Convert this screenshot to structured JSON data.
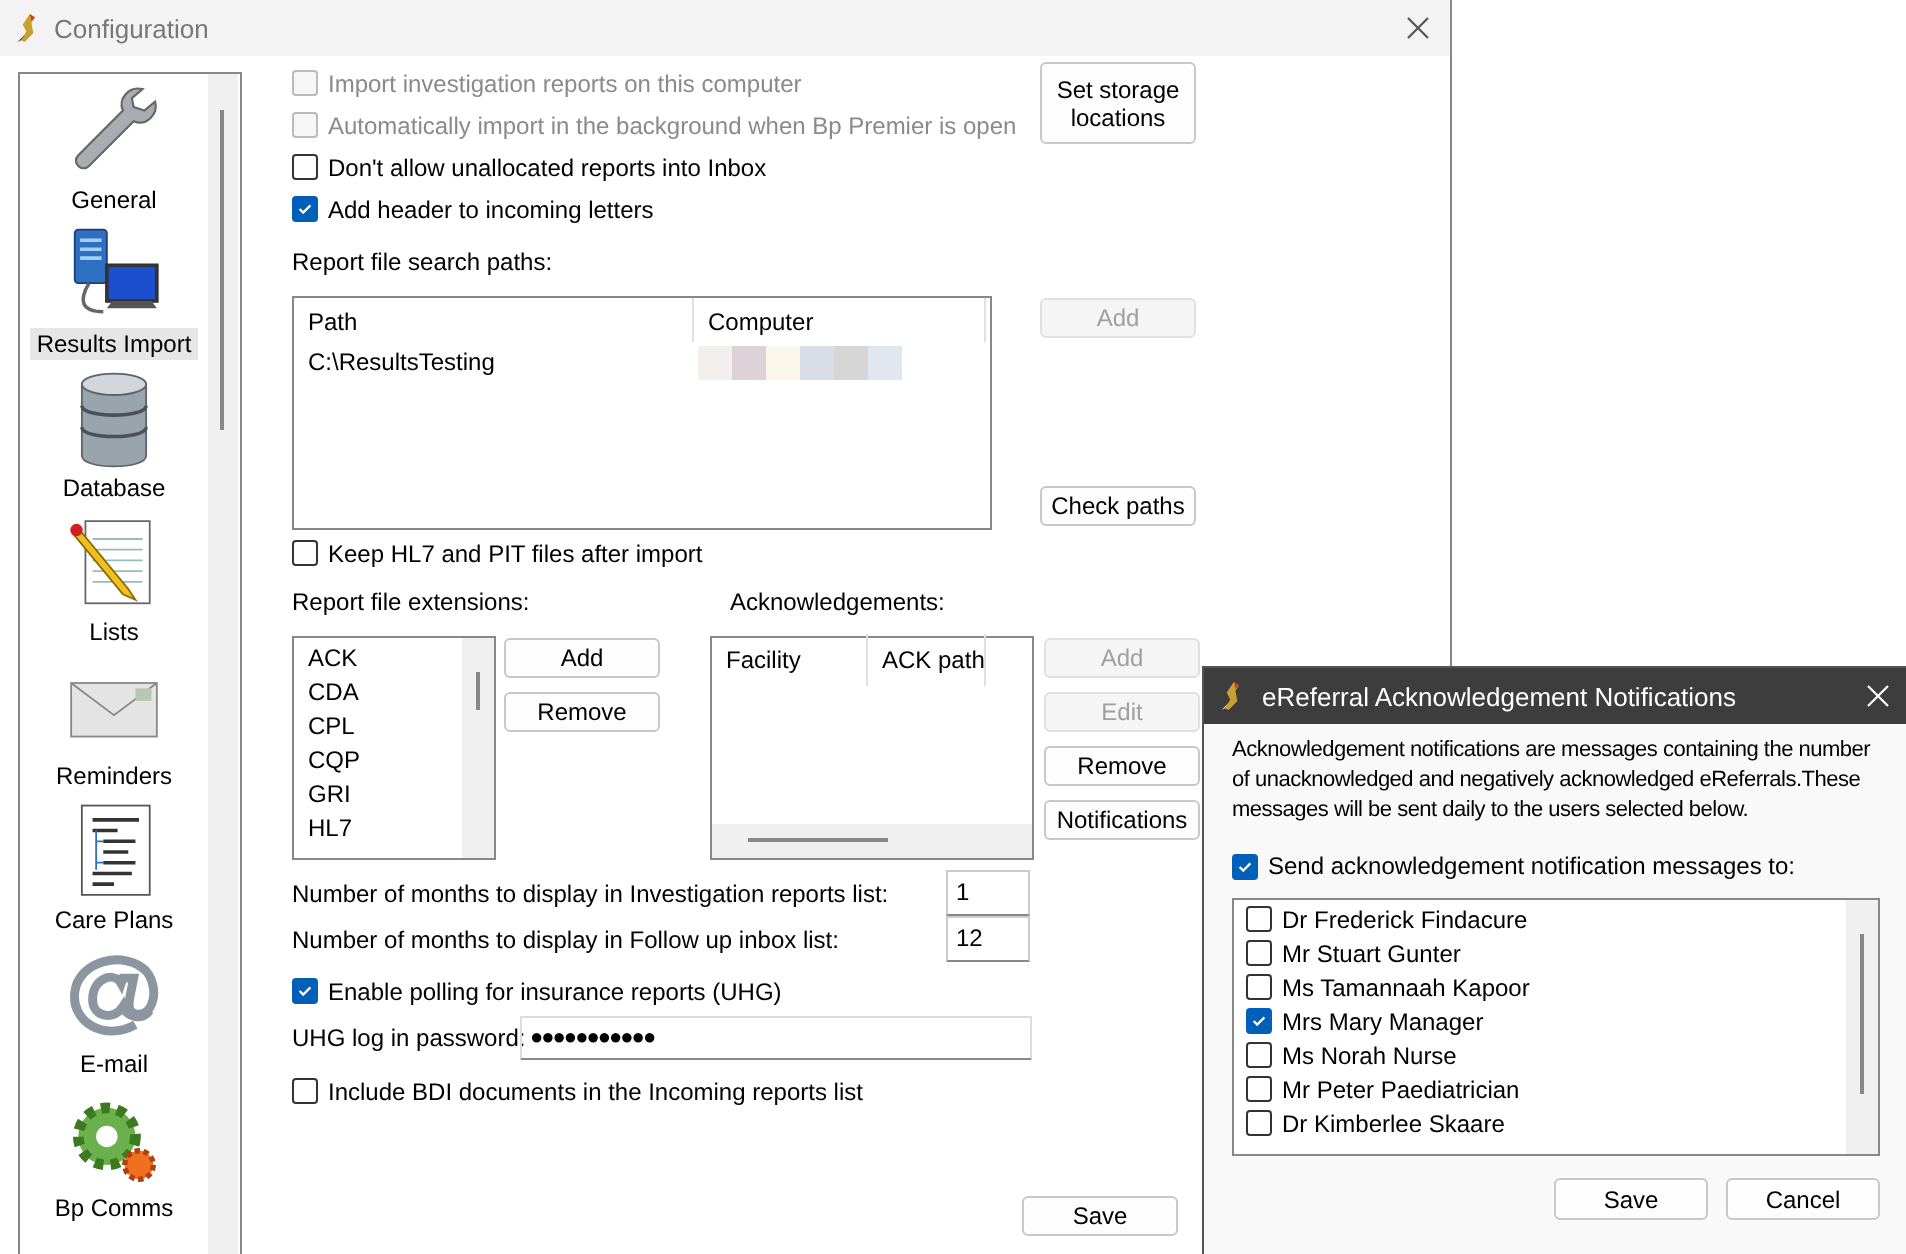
{
  "window": {
    "title": "Configuration"
  },
  "sidebar": {
    "items": [
      {
        "label": "General",
        "kind": "wrench",
        "selected": false
      },
      {
        "label": "Results Import",
        "kind": "network",
        "selected": true
      },
      {
        "label": "Database",
        "kind": "database",
        "selected": false
      },
      {
        "label": "Lists",
        "kind": "notepad",
        "selected": false
      },
      {
        "label": "Reminders",
        "kind": "envelope",
        "selected": false
      },
      {
        "label": "Care Plans",
        "kind": "document",
        "selected": false
      },
      {
        "label": "E-mail",
        "kind": "email",
        "selected": false
      },
      {
        "label": "Bp Comms",
        "kind": "gears",
        "selected": false
      }
    ]
  },
  "options": [
    {
      "label": "Import investigation reports on this computer",
      "checked": false,
      "disabled": true
    },
    {
      "label": "Automatically import in the background when Bp Premier is open",
      "checked": false,
      "disabled": true
    },
    {
      "label": "Don't allow unallocated reports into Inbox",
      "checked": false,
      "disabled": false
    },
    {
      "label": "Add header to incoming letters",
      "checked": true,
      "disabled": false
    }
  ],
  "set_storage_button": "Set storage locations",
  "search_paths": {
    "label": "Report file search paths:",
    "columns": [
      "Path",
      "Computer"
    ],
    "rows": [
      {
        "path": "C:\\ResultsTesting"
      }
    ],
    "buttons": [
      {
        "label": "Add",
        "disabled": true
      },
      {
        "label": "Check paths",
        "disabled": false
      }
    ]
  },
  "keep_files": {
    "label": "Keep HL7 and PIT files after import",
    "checked": false
  },
  "extensions": {
    "label": "Report file extensions:",
    "items": [
      "ACK",
      "CDA",
      "CPL",
      "CQP",
      "GRI",
      "HL7"
    ],
    "buttons": [
      {
        "label": "Add",
        "disabled": false
      },
      {
        "label": "Remove",
        "disabled": false
      }
    ]
  },
  "acknowledgements": {
    "label": "Acknowledgements:",
    "columns": [
      "Facility",
      "ACK path"
    ],
    "buttons": [
      {
        "label": "Add",
        "disabled": true
      },
      {
        "label": "Edit",
        "disabled": true
      },
      {
        "label": "Remove",
        "disabled": false
      },
      {
        "label": "Notifications",
        "disabled": false
      }
    ]
  },
  "month_fields": [
    {
      "label": "Number of months to display in Investigation reports list:",
      "value": "1"
    },
    {
      "label": "Number of months to display in Follow up inbox list:",
      "value": "12"
    }
  ],
  "polling": {
    "label": "Enable polling for insurance reports (UHG)",
    "checked": true
  },
  "password": {
    "label": "UHG log in password:",
    "value": "●●●●●●●●●●●"
  },
  "include_bdi": {
    "label": "Include BDI documents in the Incoming reports list",
    "checked": false
  },
  "save_button": "Save",
  "dialog": {
    "title": "eReferral Acknowledgement Notifications",
    "description": "Acknowledgement notifications are messages containing the number of unacknowledged and negatively acknowledged eReferrals.These messages will be sent daily to the users selected below.",
    "send_to": {
      "label": "Send acknowledgement notification messages to:",
      "checked": true
    },
    "users": [
      {
        "name": "Dr Frederick Findacure",
        "checked": false
      },
      {
        "name": "Mr Stuart Gunter",
        "checked": false
      },
      {
        "name": "Ms Tamannaah Kapoor",
        "checked": false
      },
      {
        "name": "Mrs Mary Manager",
        "checked": true
      },
      {
        "name": "Ms Norah Nurse",
        "checked": false
      },
      {
        "name": "Mr Peter Paediatrician",
        "checked": false
      },
      {
        "name": "Dr Kimberlee Skaare",
        "checked": false
      }
    ],
    "buttons": [
      {
        "label": "Save"
      },
      {
        "label": "Cancel"
      }
    ]
  }
}
